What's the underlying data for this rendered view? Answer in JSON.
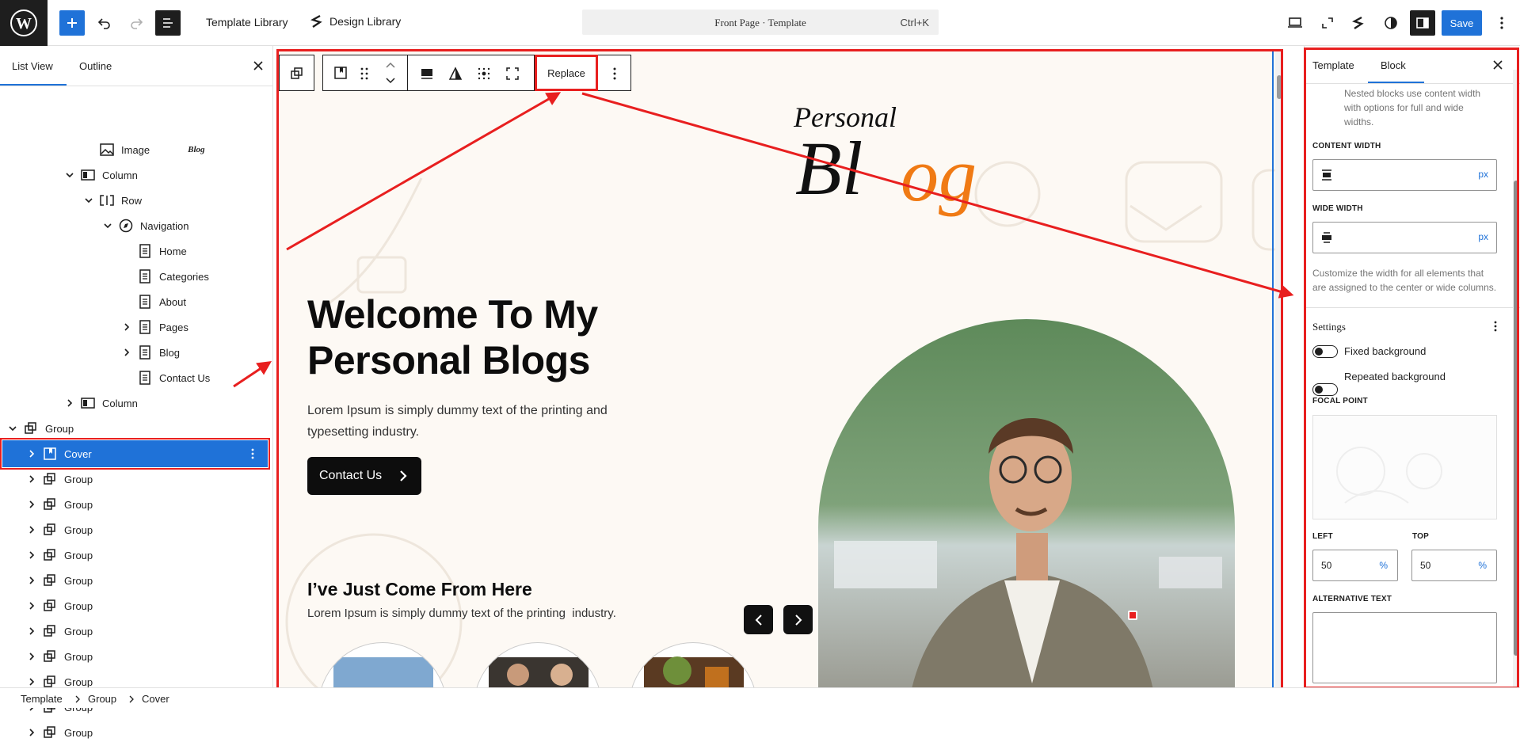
{
  "topbar": {
    "template_library": "Template Library",
    "design_library": "Design Library",
    "command_title": "Front Page · Template",
    "command_shortcut": "Ctrl+K",
    "save_label": "Save"
  },
  "left_panel": {
    "tabs": [
      "List View",
      "Outline"
    ],
    "tree": [
      {
        "label": "Image",
        "icon": "image-icon",
        "expander": "none",
        "depth": 4,
        "thumb": "Blog"
      },
      {
        "label": "Column",
        "icon": "column-icon",
        "expander": "expanded",
        "depth": 3
      },
      {
        "label": "Row",
        "icon": "row-icon",
        "expander": "expanded",
        "depth": 4
      },
      {
        "label": "Navigation",
        "icon": "navigation-icon",
        "expander": "expanded",
        "depth": 5
      },
      {
        "label": "Home",
        "icon": "page-icon",
        "expander": "none",
        "depth": 6
      },
      {
        "label": "Categories",
        "icon": "page-icon",
        "expander": "none",
        "depth": 6
      },
      {
        "label": "About",
        "icon": "page-icon",
        "expander": "none",
        "depth": 6
      },
      {
        "label": "Pages",
        "icon": "page-icon",
        "expander": "collapsed",
        "depth": 6
      },
      {
        "label": "Blog",
        "icon": "page-icon",
        "expander": "collapsed",
        "depth": 6
      },
      {
        "label": "Contact Us",
        "icon": "page-icon",
        "expander": "none",
        "depth": 6
      },
      {
        "label": "Column",
        "icon": "column-icon",
        "expander": "collapsed",
        "depth": 3
      },
      {
        "label": "Group",
        "icon": "group-icon",
        "expander": "expanded",
        "depth": 0
      },
      {
        "label": "Cover",
        "icon": "cover-icon",
        "expander": "collapsed",
        "depth": 1,
        "selected": true
      },
      {
        "label": "Group",
        "icon": "group-icon",
        "expander": "collapsed",
        "depth": 1
      },
      {
        "label": "Group",
        "icon": "group-icon",
        "expander": "collapsed",
        "depth": 1
      },
      {
        "label": "Group",
        "icon": "group-icon",
        "expander": "collapsed",
        "depth": 1
      },
      {
        "label": "Group",
        "icon": "group-icon",
        "expander": "collapsed",
        "depth": 1
      },
      {
        "label": "Group",
        "icon": "group-icon",
        "expander": "collapsed",
        "depth": 1
      },
      {
        "label": "Group",
        "icon": "group-icon",
        "expander": "collapsed",
        "depth": 1
      },
      {
        "label": "Group",
        "icon": "group-icon",
        "expander": "collapsed",
        "depth": 1
      },
      {
        "label": "Group",
        "icon": "group-icon",
        "expander": "collapsed",
        "depth": 1
      },
      {
        "label": "Group",
        "icon": "group-icon",
        "expander": "collapsed",
        "depth": 1
      },
      {
        "label": "Group",
        "icon": "group-icon",
        "expander": "collapsed",
        "depth": 1
      },
      {
        "label": "Group",
        "icon": "group-icon",
        "expander": "collapsed",
        "depth": 1
      }
    ]
  },
  "breadcrumb": [
    "Template",
    "Group",
    "Cover"
  ],
  "block_toolbar": {
    "replace_label": "Replace"
  },
  "canvas": {
    "logo_script": "Personal",
    "logo_big_dark": "Bl",
    "logo_big_orange": "og",
    "hero_title_line1": "Welcome To My",
    "hero_title_line2": "Personal Blogs",
    "hero_text_line1": "Lorem Ipsum is simply dummy text of the printing and",
    "hero_text_line2": "typesetting industry.",
    "contact_button": "Contact Us",
    "section_title": "I’ve Just Come From Here",
    "section_text": "Lorem Ipsum is simply dummy text of the printing  industry."
  },
  "right_panel": {
    "tabs": [
      "Template",
      "Block"
    ],
    "intro": [
      "Nested blocks use content width",
      "with options for full and wide",
      "widths."
    ],
    "content_width_label": "CONTENT WIDTH",
    "wide_width_label": "WIDE WIDTH",
    "unit_px": "px",
    "width_help": [
      "Customize the width for all elements that",
      "are assigned to the center or wide columns."
    ],
    "settings_title": "Settings",
    "fixed_background": "Fixed background",
    "repeated_background": "Repeated background",
    "focal_point_label": "FOCAL POINT",
    "left_label": "LEFT",
    "top_label": "TOP",
    "left_value": "50",
    "top_value": "50",
    "unit_percent": "%",
    "alt_text_label": "ALTERNATIVE TEXT"
  },
  "colors": {
    "accent": "#1f72d8",
    "annotation_red": "#e81f1f",
    "logo_orange": "#f07a14",
    "canvas_bg": "#fdf9f4"
  }
}
